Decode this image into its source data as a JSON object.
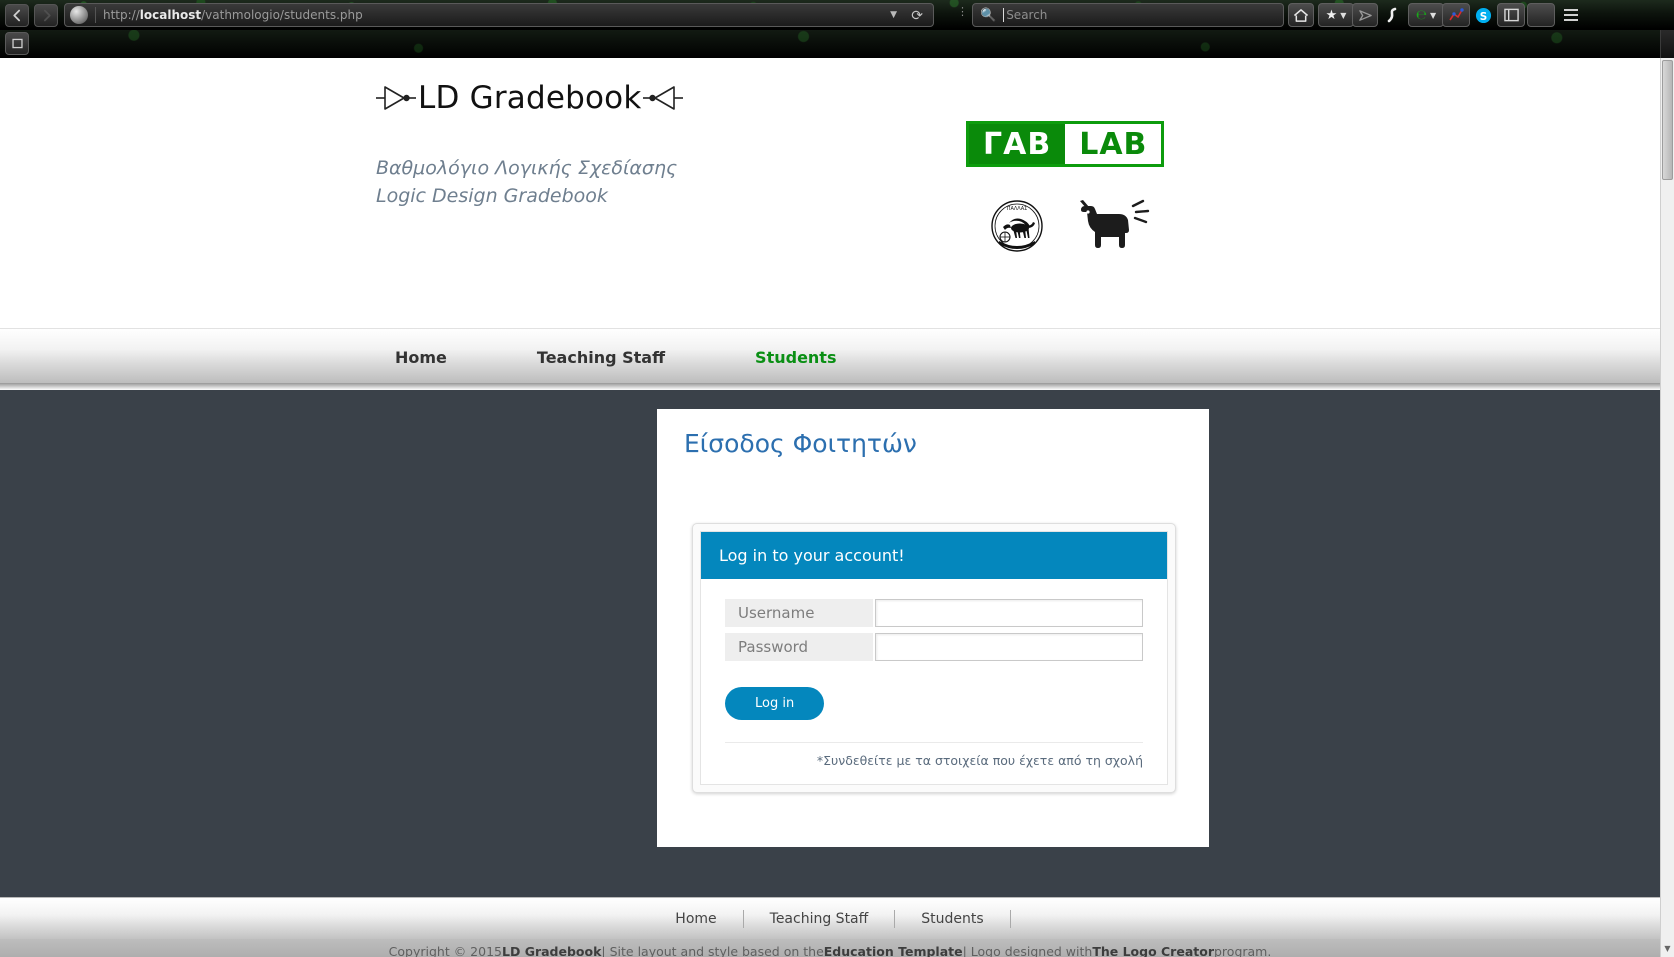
{
  "browser": {
    "back_icon": "back-arrow-icon",
    "forward_icon": "forward-arrow-icon",
    "url_prefix": "http://",
    "url_host": "localhost",
    "url_path": "/vathmologio/students.php",
    "url_dropdown_icon": "chevron-down-icon",
    "reload_icon": "reload-icon",
    "search_placeholder": "Search",
    "search_icon": "search-icon",
    "toolbar_icons": [
      "home-icon",
      "bookmark-star-icon",
      "chevron-down-icon",
      "pocket-icon",
      "s-curve-icon",
      "evernote-icon",
      "chevron-down-icon",
      "analytics-icon",
      "skype-icon",
      "sidebar-panel-icon",
      "blank-icon",
      "hamburger-menu-icon"
    ],
    "tab_button_icon": "new-tab-icon"
  },
  "header": {
    "logo_text": "LD Gradebook",
    "logo_left_icon": "not-gate-icon",
    "logo_right_icon": "not-gate-icon",
    "subtitle_greek": "Βαθμολόγιο Λογικής Σχεδίασης",
    "subtitle_english": "Logic Design Gradebook",
    "gablab_left": "ΓΑΒ",
    "gablab_right": "LAB",
    "seal_icon": "university-seal-icon",
    "dog_icon": "barking-dog-icon"
  },
  "nav": {
    "items": [
      {
        "label": "Home",
        "active": false
      },
      {
        "label": "Teaching Staff",
        "active": false
      },
      {
        "label": "Students",
        "active": true
      }
    ]
  },
  "main": {
    "page_title": "Είσοδος Φοιτητών",
    "login_panel": {
      "heading": "Log in to your account!",
      "username_label": "Username",
      "username_value": "",
      "username_placeholder": "",
      "password_label": "Password",
      "password_value": "",
      "password_placeholder": "",
      "submit_label": "Log in",
      "note": "*Συνδεθείτε με τα στοιχεία που έχετε από τη σχολή"
    }
  },
  "footer": {
    "links": [
      "Home",
      "Teaching Staff",
      "Students"
    ],
    "copyright_1": "Copyright © 2015 ",
    "copyright_brand": "LD Gradebook",
    "copyright_2": " | Site layout and style based on the ",
    "copyright_template": "Education Template",
    "copyright_3": " | Logo designed with ",
    "copyright_creator": "The Logo Creator",
    "copyright_4": " program."
  },
  "colors": {
    "accent_blue": "#0487bd",
    "title_blue": "#2c6faf",
    "active_green": "#0a8f14",
    "brand_green": "#0a8a0a",
    "dark_bg": "#3a4149"
  }
}
